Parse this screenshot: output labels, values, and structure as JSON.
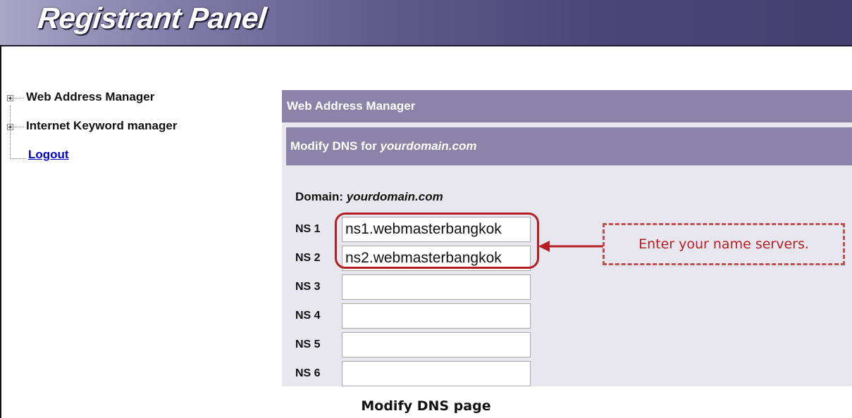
{
  "header": {
    "title": "Registrant Panel"
  },
  "tree": {
    "items": [
      {
        "label": "Web Address Manager"
      },
      {
        "label": "Internet Keyword manager"
      }
    ],
    "logout_label": "Logout"
  },
  "main": {
    "section_title": "Web Address Manager",
    "modify_prefix": "Modify DNS for ",
    "domain_name": "yourdomain.com",
    "domain_label": "Domain: ",
    "nameservers": [
      {
        "label": "NS 1",
        "value": "ns1.webmasterbangkok"
      },
      {
        "label": "NS 2",
        "value": "ns2.webmasterbangkok"
      },
      {
        "label": "NS 3",
        "value": ""
      },
      {
        "label": "NS 4",
        "value": ""
      },
      {
        "label": "NS 5",
        "value": ""
      },
      {
        "label": "NS 6",
        "value": ""
      }
    ]
  },
  "annotation": {
    "callout_text": "Enter your name servers.",
    "color": "#b51e22"
  },
  "caption": "Modify DNS page",
  "colors": {
    "header_dark": "#443f6f",
    "bar": "#8b84a8",
    "panel_bg": "#e8e6ef",
    "link": "#0000cc"
  }
}
